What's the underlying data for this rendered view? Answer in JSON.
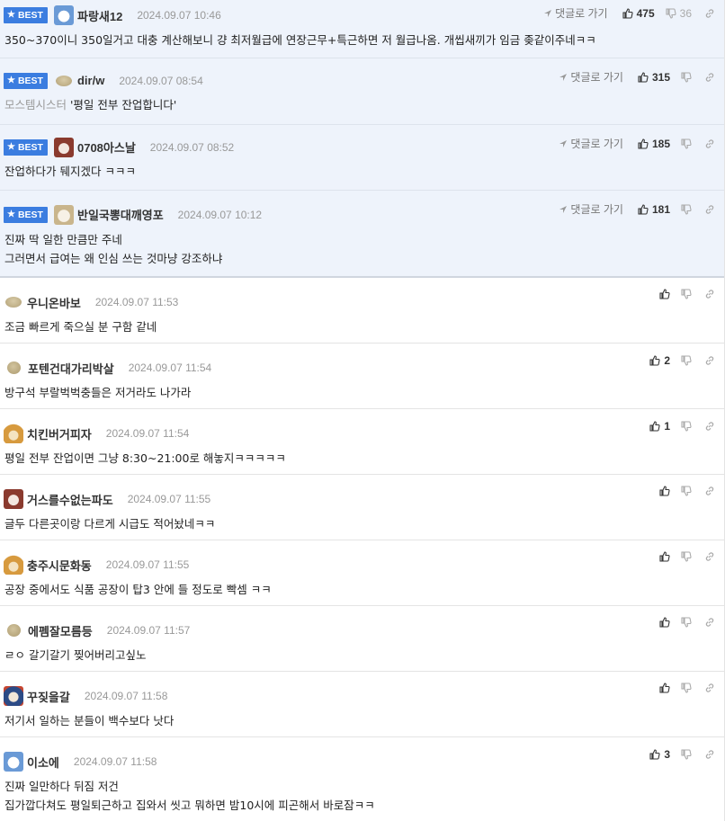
{
  "labels": {
    "best": "BEST",
    "reply_link": "댓글로 가기"
  },
  "colors": {
    "best_badge": "#3b7de0",
    "best_row_bg": "#eef3fb",
    "date": "#999999"
  },
  "best_comments": [
    {
      "nick": "파랑새12",
      "date": "2024.09.07 10:46",
      "likes": "475",
      "dislikes": "36",
      "lines": [
        "350~370이니 350일거고 대충 계산해보니 걍 최저월급에 연장근무+특근하면 저 월급나옴. 개씹새끼가 임금 좆같이주네ㅋㅋ"
      ]
    },
    {
      "nick": "dir/w",
      "date": "2024.09.07 08:54",
      "likes": "315",
      "source": "모스템시스터",
      "lines": [
        "'평일 전부 잔업합니다'"
      ]
    },
    {
      "nick": "0708아스날",
      "date": "2024.09.07 08:52",
      "likes": "185",
      "lines": [
        "잔업하다가 뒈지겠다 ㅋㅋㅋ"
      ]
    },
    {
      "nick": "반일국뽕대깨영포",
      "date": "2024.09.07 10:12",
      "likes": "181",
      "lines": [
        "진짜 딱 일한 만큼만 주네",
        "그러면서 급여는 왜 인심 쓰는 것마냥 강조하냐"
      ]
    }
  ],
  "comments": [
    {
      "nick": "우니온바보",
      "date": "2024.09.07 11:53",
      "likes": "",
      "lines": [
        "조금 빠르게 죽으실 분 구함 같네"
      ]
    },
    {
      "nick": "포텐건대가리박살",
      "date": "2024.09.07 11:54",
      "likes": "2",
      "lines": [
        "방구석 부랄벅벅충들은 저거라도 나가라"
      ]
    },
    {
      "nick": "치킨버거피자",
      "date": "2024.09.07 11:54",
      "likes": "1",
      "lines": [
        "평일 전부 잔업이면 그냥 8:30~21:00로 해놓지ㅋㅋㅋㅋㅋ"
      ]
    },
    {
      "nick": "거스를수없는파도",
      "date": "2024.09.07 11:55",
      "likes": "",
      "lines": [
        "글두 다른곳이랑 다르게 시급도 적어놨네ㅋㅋ"
      ]
    },
    {
      "nick": "충주시문화동",
      "date": "2024.09.07 11:55",
      "likes": "",
      "lines": [
        "공장 중에서도 식품 공장이 탑3 안에 들 정도로 빡셈 ㅋㅋ"
      ]
    },
    {
      "nick": "에펨잘모름등",
      "date": "2024.09.07 11:57",
      "likes": "",
      "lines": [
        "ㄹㅇ 갈기갈기 찢어버리고싶노"
      ]
    },
    {
      "nick": "꾸짖을갈",
      "date": "2024.09.07 11:58",
      "likes": "",
      "lines": [
        "저기서 일하는 분들이 백수보다 낫다"
      ]
    },
    {
      "nick": "이소에",
      "date": "2024.09.07 11:58",
      "likes": "3",
      "lines": [
        "진짜 일만하다 뒤짐 저건",
        "집가깝다쳐도 평일퇴근하고 집와서 씻고 뭐하면 밤10시에 피곤해서 바로잠ㅋㅋ"
      ]
    }
  ]
}
